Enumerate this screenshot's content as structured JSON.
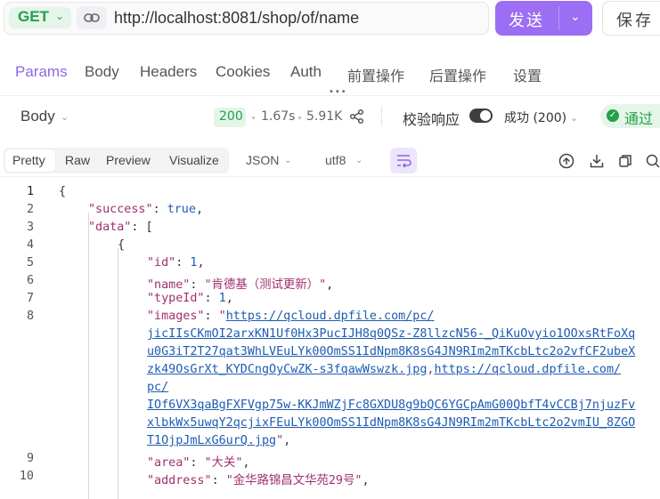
{
  "request": {
    "method": "GET",
    "url": "http://localhost:8081/shop/of/name",
    "send_label": "发送",
    "save_label": "保存"
  },
  "tabs": [
    "Params",
    "Body",
    "Headers",
    "Cookies",
    "Auth",
    "前置操作",
    "后置操作",
    "设置"
  ],
  "response": {
    "body_label": "Body",
    "status_code": "200",
    "time": "1.67s",
    "size": "5.91K",
    "validate_label": "校验响应",
    "validate_enabled": true,
    "result": "成功 (200)",
    "pass_label": "通过"
  },
  "view": {
    "tabs": [
      "Pretty",
      "Raw",
      "Preview",
      "Visualize"
    ],
    "active_tab": "Pretty",
    "format": "JSON",
    "encoding": "utf8"
  },
  "code": {
    "line_numbers": [
      "1",
      "2",
      "3",
      "4",
      "5",
      "6",
      "7",
      "8",
      "9",
      "10"
    ],
    "open_brace": "{",
    "success_key": "\"success\"",
    "success_val": "true",
    "data_key": "\"data\"",
    "data_open": "[",
    "item_open": "{",
    "id_key": "\"id\"",
    "id_val": "1",
    "name_key": "\"name\"",
    "name_val": "\"肯德基（测试更新）\"",
    "typeid_key": "\"typeId\"",
    "typeid_val": "1",
    "images_key": "\"images\"",
    "images_val_lines": [
      "https://qcloud.dpfile.com/pc/",
      "jicIIsCKmOI2arxKN1Uf0Hx3PucIJH8q0QSz-Z8llzcN56-_QiKuOvyio1OOxsRtFoXq",
      "u0G3iT2T27qat3WhLVEuLYk00OmSS1IdNpm8K8sG4JN9RIm2mTKcbLtc2o2vfCF2ubeX",
      "zk49OsGrXt_KYDCngOyCwZK-s3fqawWswzk.jpg",
      "https://qcloud.dpfile.com/",
      "pc/",
      "IOf6VX3qaBgFXFVgp75w-KKJmWZjFc8GXDU8g9bQC6YGCpAmG00QbfT4vCCBj7njuzFv",
      "xlbkWx5uwqY2qcjixFEuLYk00OmSS1IdNpm8K8sG4JN9RIm2mTKcbLtc2o2vmIU_8ZGO",
      "T1OjpJmLxG6urQ.jpg"
    ],
    "area_key": "\"area\"",
    "area_val": "\"大关\"",
    "address_key": "\"address\"",
    "address_val": "\"金华路锦昌文华苑29号\""
  }
}
